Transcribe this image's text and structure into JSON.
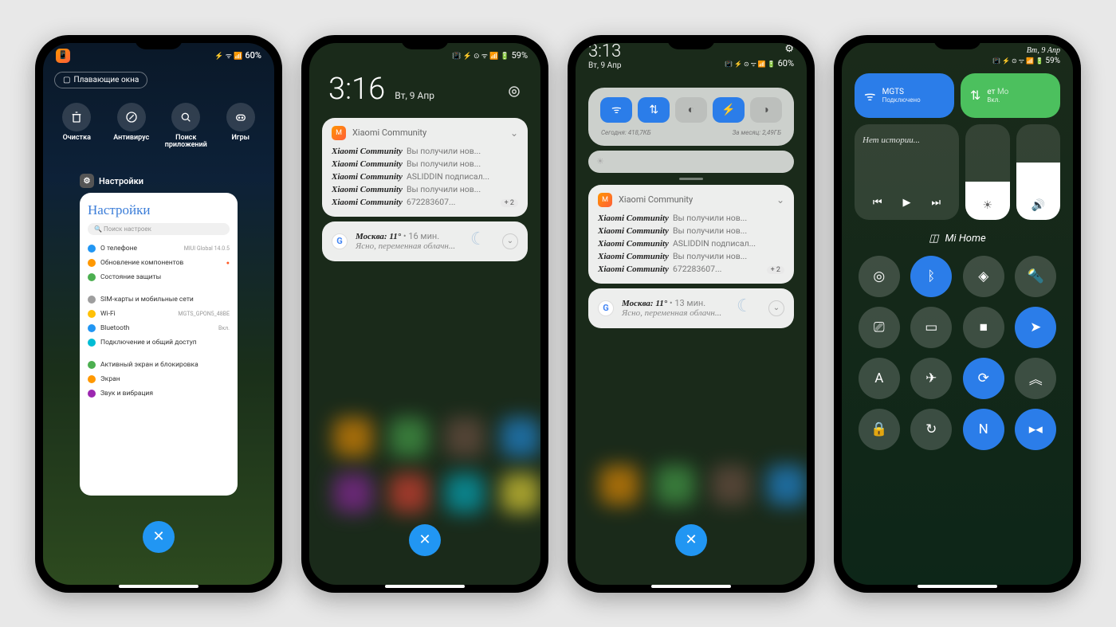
{
  "phone1": {
    "status": {
      "battery": "60%",
      "icons": "⚡ 📶 🔋"
    },
    "floating_label": "Плавающие окна",
    "tools": [
      {
        "icon": "trash",
        "label": "Очистка"
      },
      {
        "icon": "shield",
        "label": "Антивирус"
      },
      {
        "icon": "search",
        "label": "Поиск приложений"
      },
      {
        "icon": "game",
        "label": "Игры"
      }
    ],
    "card": {
      "header_label": "Настройки",
      "title": "Настройки",
      "search_placeholder": "Поиск настроек",
      "items": [
        {
          "color": "#2196f3",
          "label": "О телефоне",
          "value": "MIUI Global 14.0.5"
        },
        {
          "color": "#ff9800",
          "label": "Обновление компонентов",
          "value": "●",
          "badge": true
        },
        {
          "color": "#4caf50",
          "label": "Состояние защиты",
          "value": ""
        }
      ],
      "items2": [
        {
          "color": "#9e9e9e",
          "label": "SIM-карты и мобильные сети",
          "value": ""
        },
        {
          "color": "#ffc107",
          "label": "Wi-Fi",
          "value": "MGTS_GPON5_48BE"
        },
        {
          "color": "#2196f3",
          "label": "Bluetooth",
          "value": "Вкл."
        },
        {
          "color": "#00bcd4",
          "label": "Подключение и общий доступ",
          "value": ""
        }
      ],
      "items3": [
        {
          "color": "#4caf50",
          "label": "Активный экран и блокировка",
          "value": ""
        },
        {
          "color": "#ff9800",
          "label": "Экран",
          "value": ""
        },
        {
          "color": "#9c27b0",
          "label": "Звук и вибрация",
          "value": ""
        }
      ]
    }
  },
  "phone2": {
    "status_battery": "59%",
    "time": "3:16",
    "date": "Вт, 9 Апр",
    "xiaomi": {
      "app": "Xiaomi Community",
      "lines": [
        {
          "from": "Xiaomi Community",
          "msg": "Вы получили нов..."
        },
        {
          "from": "Xiaomi Community",
          "msg": "Вы получили нов..."
        },
        {
          "from": "Xiaomi Community",
          "msg": "ASLIDDIN подписал..."
        },
        {
          "from": "Xiaomi Community",
          "msg": "Вы получили нов..."
        },
        {
          "from": "Xiaomi Community",
          "msg": "672283607..."
        }
      ],
      "badge": "+ 2"
    },
    "weather": {
      "title": "Москва: 11°",
      "time": "• 16 мин.",
      "desc": "Ясно, переменная облачн..."
    }
  },
  "phone3": {
    "time": "3:13",
    "date": "Вт, 9 Апр",
    "status_battery": "60%",
    "qs": [
      {
        "icon": "wifi",
        "on": true
      },
      {
        "icon": "data",
        "on": true
      },
      {
        "icon": "dnd",
        "on": false
      },
      {
        "icon": "bt",
        "on": true
      },
      {
        "icon": "dark",
        "on": false
      }
    ],
    "stats_today": "Сегодня: 418,7КБ",
    "stats_month": "За месяц: 2,49ГБ",
    "xiaomi": {
      "app": "Xiaomi Community",
      "lines": [
        {
          "from": "Xiaomi Community",
          "msg": "Вы получили нов..."
        },
        {
          "from": "Xiaomi Community",
          "msg": "Вы получили нов..."
        },
        {
          "from": "Xiaomi Community",
          "msg": "ASLIDDIN подписал..."
        },
        {
          "from": "Xiaomi Community",
          "msg": "Вы получили нов..."
        },
        {
          "from": "Xiaomi Community",
          "msg": "672283607..."
        }
      ],
      "badge": "+ 2"
    },
    "weather": {
      "title": "Москва: 11°",
      "time": "• 13 мин.",
      "desc": "Ясно, переменная облачн..."
    }
  },
  "phone4": {
    "date": "Вт, 9 Апр",
    "status_battery": "59%",
    "wifi": {
      "name": "MGTS",
      "status": "Подключено"
    },
    "data": {
      "name": "ет",
      "status": "Вкл.",
      "prefix": "Мо"
    },
    "media_text": "Нет истории...",
    "mihome": "Mi Home",
    "toggles": [
      {
        "icon": "target",
        "on": false
      },
      {
        "icon": "bt",
        "on": true
      },
      {
        "icon": "sync",
        "on": false
      },
      {
        "icon": "flash",
        "on": false
      },
      {
        "icon": "cast",
        "on": false
      },
      {
        "icon": "battery",
        "on": false
      },
      {
        "icon": "video",
        "on": false
      },
      {
        "icon": "location",
        "on": true
      },
      {
        "icon": "font",
        "on": false
      },
      {
        "icon": "airplane",
        "on": false
      },
      {
        "icon": "rotate",
        "on": true
      },
      {
        "icon": "up",
        "on": false
      },
      {
        "icon": "lock",
        "on": false
      },
      {
        "icon": "refresh",
        "on": false
      },
      {
        "icon": "nfc",
        "on": true
      },
      {
        "icon": "dual",
        "on": true
      }
    ]
  }
}
